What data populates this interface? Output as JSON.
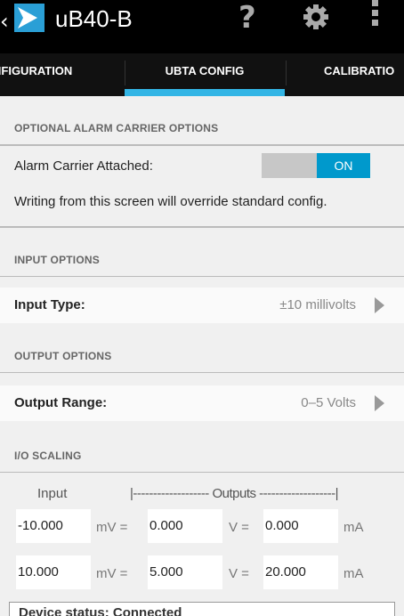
{
  "app": {
    "title": "uB40-B",
    "icons": {
      "back": "chevron-left-icon",
      "logo": "app-logo-icon",
      "help": "question-icon",
      "settings": "gear-icon",
      "overflow": "overflow-menu-icon"
    },
    "colors": {
      "accent": "#33b5e5",
      "toggle_on": "#0099cc",
      "actionbar": "#000000"
    }
  },
  "tabs": [
    {
      "label": "NFIGURATION"
    },
    {
      "label": "UBTA CONFIG",
      "selected": true
    },
    {
      "label": "CALIBRATIO"
    }
  ],
  "alarm": {
    "header": "OPTIONAL ALARM CARRIER OPTIONS",
    "label": "Alarm Carrier Attached:",
    "toggle": "ON",
    "note": "Writing from this screen will override standard config."
  },
  "input": {
    "header": "INPUT OPTIONS",
    "label": "Input Type:",
    "value": "±10 millivolts"
  },
  "output": {
    "header": "OUTPUT OPTIONS",
    "label": "Output Range:",
    "value": "0–5 Volts"
  },
  "scaling": {
    "header": "I/O SCALING",
    "input_col": "Input",
    "outputs_col": "|------------------- Outputs -------------------|",
    "rows": [
      {
        "input": "-10.000",
        "u1": "mV =",
        "volts": "0.000",
        "u2": "V =",
        "ma": "0.000",
        "u3": "mA"
      },
      {
        "input": "10.000",
        "u1": "mV =",
        "volts": "5.000",
        "u2": "V =",
        "ma": "20.000",
        "u3": "mA"
      }
    ]
  },
  "status": {
    "text": "Device status:  Connected"
  }
}
